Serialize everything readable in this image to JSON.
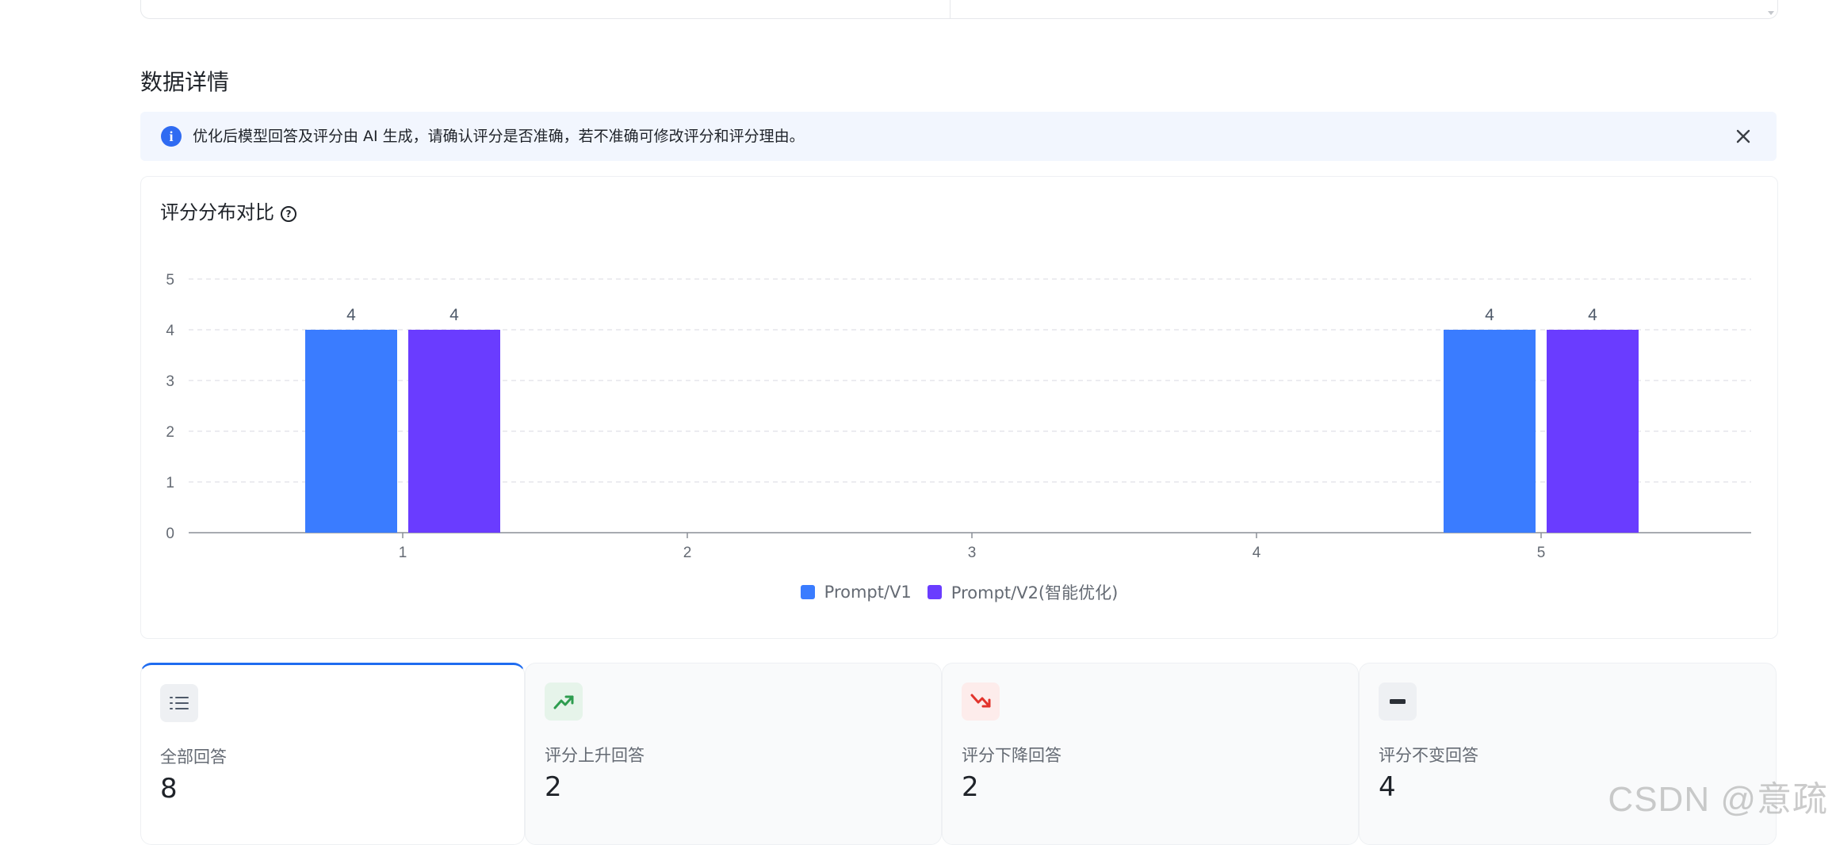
{
  "section": {
    "title": "数据详情"
  },
  "banner": {
    "message": "优化后模型回答及评分由 AI 生成，请确认评分是否准确，若不准确可修改评分和评分理由。",
    "icon": "info-icon",
    "close_icon": "close-icon",
    "accent": "#2f6bf2"
  },
  "chart_card": {
    "title": "评分分布对比",
    "help_icon": "help-icon"
  },
  "chart_data": {
    "type": "bar",
    "title": "评分分布对比",
    "categories": [
      "1",
      "2",
      "3",
      "4",
      "5"
    ],
    "series": [
      {
        "name": "Prompt/V1",
        "color": "#3a7cff",
        "values": [
          4,
          0,
          0,
          0,
          4
        ]
      },
      {
        "name": "Prompt/V2(智能优化)",
        "color": "#6a3cff",
        "values": [
          4,
          0,
          0,
          0,
          4
        ]
      }
    ],
    "ylim": [
      0,
      5
    ],
    "yticks": [
      0,
      1,
      2,
      3,
      4,
      5
    ],
    "xlabel": "",
    "ylabel": "",
    "grid": true,
    "legend": "bottom-center",
    "data_labels": true
  },
  "stats": [
    {
      "label": "全部回答",
      "value": "8",
      "icon": "list-icon",
      "icon_bg": "#eef0f3",
      "icon_color": "#4e5969",
      "active": true
    },
    {
      "label": "评分上升回答",
      "value": "2",
      "icon": "trend-up-icon",
      "icon_bg": "#e6f4ea",
      "icon_color": "#2e9d4f",
      "active": false
    },
    {
      "label": "评分下降回答",
      "value": "2",
      "icon": "trend-down-icon",
      "icon_bg": "#fdeceb",
      "icon_color": "#e2342c",
      "active": false
    },
    {
      "label": "评分不变回答",
      "value": "4",
      "icon": "minus-icon",
      "icon_bg": "#eef0f3",
      "icon_color": "#2b2f36",
      "active": false
    }
  ],
  "watermark": "CSDN @意疏"
}
